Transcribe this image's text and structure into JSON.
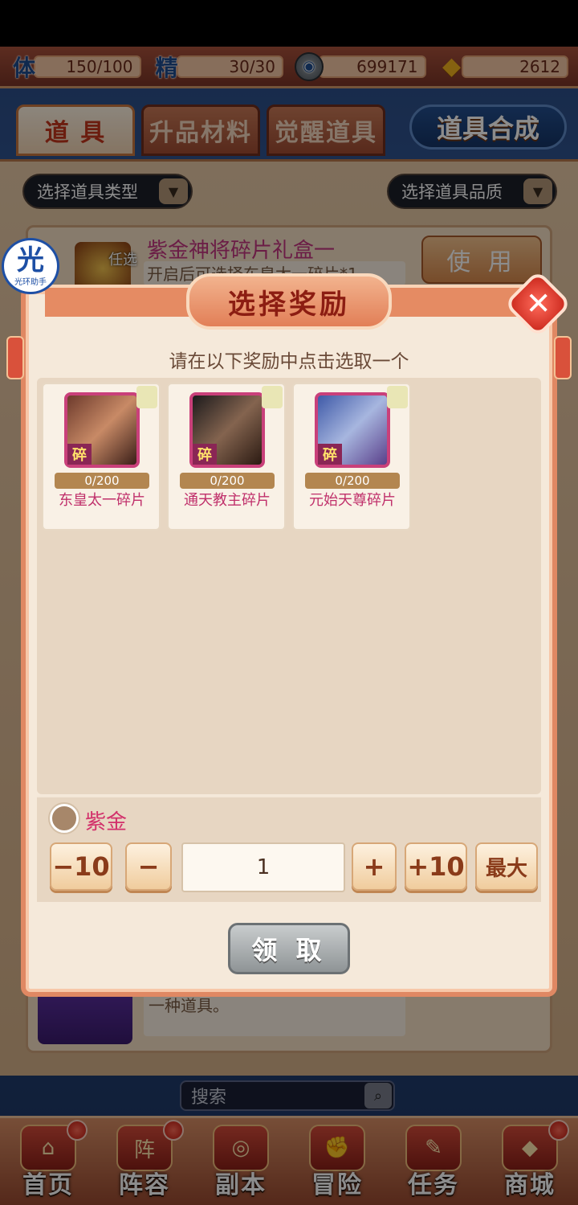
{
  "resources": [
    {
      "icon": "stamina-icon",
      "glyph": "体",
      "value": "150/100"
    },
    {
      "icon": "energy-icon",
      "glyph": "精",
      "value": "30/30"
    },
    {
      "icon": "silver-coin-icon",
      "glyph": "",
      "value": "699171"
    },
    {
      "icon": "gold-ingot-icon",
      "glyph": "",
      "value": "2612"
    }
  ],
  "tabs": [
    {
      "label": "道 具",
      "active": true
    },
    {
      "label": "升品材料",
      "active": false
    },
    {
      "label": "觉醒道具",
      "active": false
    }
  ],
  "synth_button": "道具合成",
  "filters": {
    "type": "选择道具类型",
    "quality": "选择道具品质"
  },
  "item": {
    "tag": "任选",
    "name": "紫金神将碎片礼盒一",
    "desc": "开启后可选择东皇太一碎片*1",
    "use_label": "使 用"
  },
  "bottom_item_desc": "一种道具。",
  "badge": {
    "big": "光",
    "small": "光环助手"
  },
  "modal": {
    "title": "选择奖励",
    "close_glyph": "✕",
    "prompt": "请在以下奖励中点击选取一个",
    "rewards": [
      {
        "name": "东皇太一碎片",
        "count": "0/200",
        "tag": "碎"
      },
      {
        "name": "通天教主碎片",
        "count": "0/200",
        "tag": "碎"
      },
      {
        "name": "元始天尊碎片",
        "count": "0/200",
        "tag": "碎"
      }
    ],
    "quality_label": "紫金",
    "buttons": {
      "minus10": "−10",
      "minus": "−",
      "quantity": "1",
      "plus": "+",
      "plus10": "+10",
      "max": "最大"
    },
    "claim_label": "领 取"
  },
  "search_placeholder": "搜索",
  "nav": [
    {
      "label": "首页",
      "icon": "home-icon",
      "glyph": "⌂"
    },
    {
      "label": "阵容",
      "icon": "lineup-icon",
      "glyph": "阵"
    },
    {
      "label": "副本",
      "icon": "dungeon-icon",
      "glyph": "◎"
    },
    {
      "label": "冒险",
      "icon": "adventure-icon",
      "glyph": "✊"
    },
    {
      "label": "任务",
      "icon": "quest-icon",
      "glyph": "✎"
    },
    {
      "label": "商城",
      "icon": "shop-icon",
      "glyph": "◆"
    }
  ]
}
